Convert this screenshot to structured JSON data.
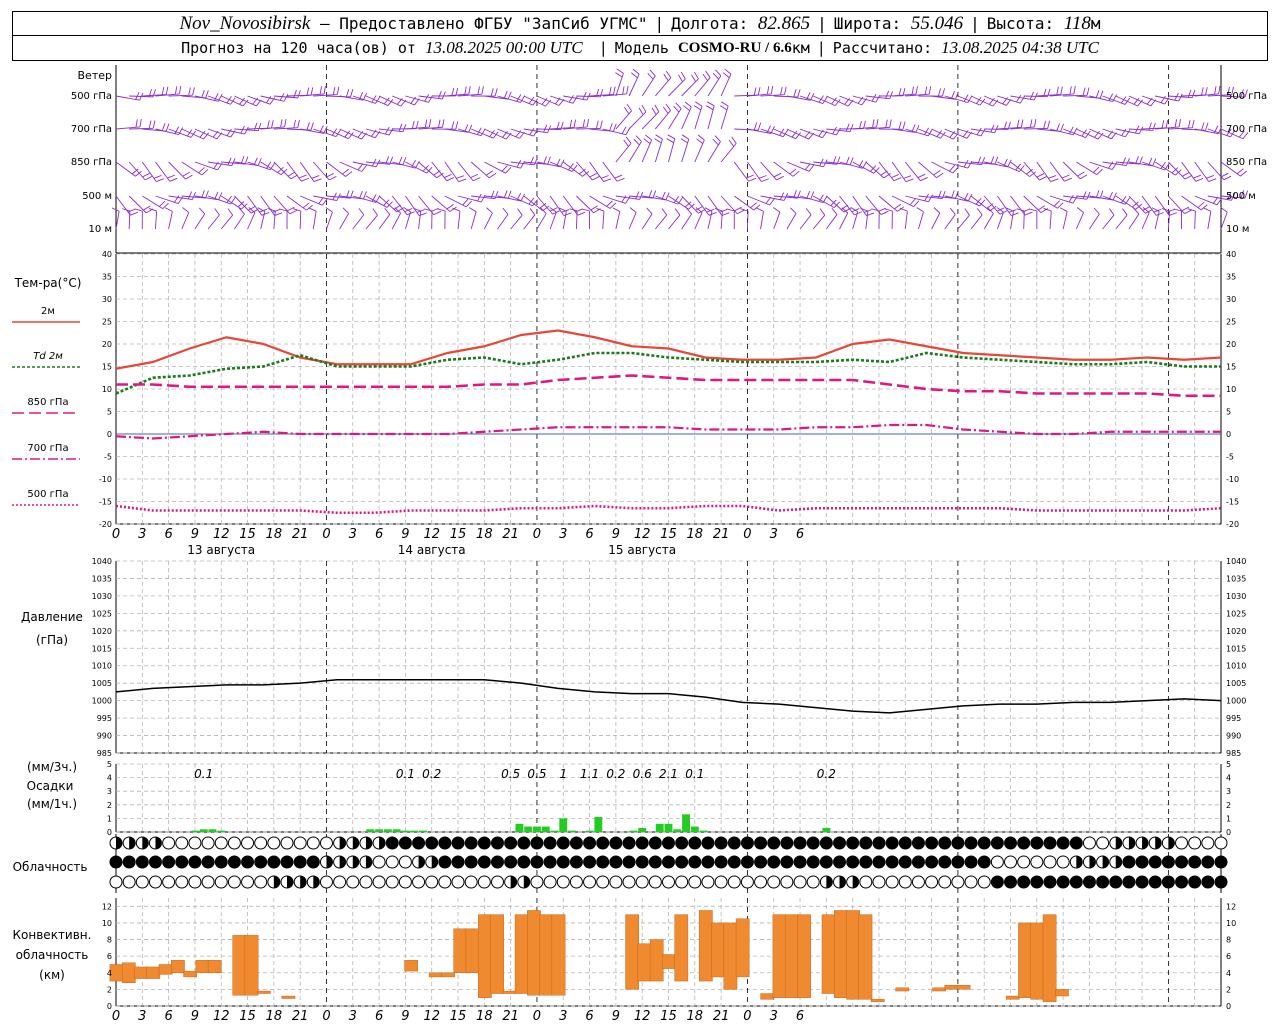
{
  "header": {
    "station": "Nov_Novosibirsk",
    "provider": "– Предоставлено ФГБУ \"ЗапСиб УГМС\"",
    "lon_label": "Долгота:",
    "lon": "82.865",
    "lat_label": "Широта:",
    "lat": "55.046",
    "alt_label": "Высота:",
    "alt": "118",
    "alt_unit": "м",
    "forecast_prefix": "Прогноз на 120 часа(ов) от",
    "run_time": "13.08.2025 00:00 UTC",
    "model_label": "Модель",
    "model": "COSMO-RU / 6.6",
    "model_unit": "км",
    "calc_label": "Рассчитано:",
    "calc_time": "13.08.2025 04:38 UTC"
  },
  "colors": {
    "wind": "#8b2bd0",
    "t2m": "#e8463a",
    "td2m": "#1b7a1b",
    "t850": "#e0187e",
    "precip": "#22cc22",
    "convective": "#f08a30",
    "pressure": "#000000"
  },
  "wind_panel": {
    "title": "Ветер",
    "levels": [
      "500 гПа",
      "700 гПа",
      "850 гПа",
      "500 м",
      "10  м"
    ]
  },
  "temp_legend": {
    "title": "Тем-ра(°C)",
    "items": [
      {
        "label": "2м",
        "prefix": "",
        "color": "#e8463a",
        "dash": ""
      },
      {
        "label": "2м",
        "prefix": "Td",
        "color": "#1b7a1b",
        "dash": "3,2"
      },
      {
        "label": "850 гПа",
        "prefix": "",
        "color": "#e0187e",
        "dash": "12,5"
      },
      {
        "label": "700 гПа",
        "prefix": "",
        "color": "#e0187e",
        "dash": "10,3,2,3"
      },
      {
        "label": "500 гПа",
        "prefix": "",
        "color": "#e0187e",
        "dash": "2,2"
      }
    ]
  },
  "time_axis": {
    "hour_labels": [
      "0",
      "3",
      "6",
      "9",
      "12",
      "15",
      "18",
      "21",
      "0",
      "3",
      "6",
      "9",
      "12",
      "15",
      "18",
      "21",
      "0",
      "3",
      "6",
      "9",
      "12",
      "15",
      "18",
      "21",
      "0",
      "3",
      "6"
    ],
    "day_labels": [
      "13 августа",
      "14 августа",
      "15 августа"
    ]
  },
  "pressure_panel": {
    "title_line1": "Давление",
    "title_line2": "(гПа)"
  },
  "precip_panel": {
    "label_3h": "(мм/3ч.)",
    "title": "Осадки",
    "label_1h": "(мм/1ч.)",
    "totals": [
      {
        "hour": 10,
        "text": "0.1"
      },
      {
        "hour": 33,
        "text": "0.1"
      },
      {
        "hour": 36,
        "text": "0.2"
      },
      {
        "hour": 45,
        "text": "0.5"
      },
      {
        "hour": 48,
        "text": "0.5"
      },
      {
        "hour": 51,
        "text": "1"
      },
      {
        "hour": 54,
        "text": "1.1"
      },
      {
        "hour": 57,
        "text": "0.2"
      },
      {
        "hour": 60,
        "text": "0.6"
      },
      {
        "hour": 63,
        "text": "2.1"
      },
      {
        "hour": 66,
        "text": "0.1"
      },
      {
        "hour": 81,
        "text": "0.2"
      }
    ]
  },
  "cloud_panel": {
    "title": "Облачность"
  },
  "conv_panel": {
    "title_line1": "Конвективн.",
    "title_line2": "облачность",
    "title_line3": "(км)"
  },
  "chart_data": [
    {
      "type": "line",
      "title": "Тем-ра(°C)",
      "x_unit": "hours from 13.08.2025 00:00 UTC",
      "ylim": [
        -20,
        40
      ],
      "grid": true,
      "x": [
        0,
        3,
        6,
        9,
        12,
        15,
        18,
        21,
        24,
        27,
        30,
        33,
        36,
        39,
        42,
        45,
        48,
        51,
        54,
        57,
        60,
        63,
        66,
        69,
        72,
        75,
        78,
        81,
        84,
        87,
        90
      ],
      "series": [
        {
          "name": "2м",
          "values": [
            14.5,
            16,
            19,
            21.5,
            20,
            17,
            15.5,
            15.5,
            15.5,
            18,
            19.5,
            22,
            23,
            21.5,
            19.5,
            19,
            17,
            16.5,
            16.5,
            17,
            20,
            21,
            19.5,
            18,
            17.5,
            17,
            16.5,
            16.5,
            17,
            16.5,
            17
          ]
        },
        {
          "name": "Td 2м",
          "values": [
            9,
            12.5,
            13,
            14.5,
            15,
            17.5,
            15,
            15,
            15,
            16.5,
            17,
            15.5,
            16.5,
            18,
            18,
            17,
            16.5,
            16,
            16,
            16,
            16.5,
            16,
            18,
            17,
            16.5,
            16,
            15.5,
            15.5,
            16,
            15,
            15
          ]
        },
        {
          "name": "850 гПа",
          "values": [
            11,
            11,
            10.5,
            10.5,
            10.5,
            10.5,
            10.5,
            10.5,
            10.5,
            10.5,
            11,
            11,
            12,
            12.5,
            13,
            12.5,
            12,
            12,
            12,
            12,
            12,
            11,
            10,
            9.5,
            9.5,
            9,
            9,
            9,
            9,
            8.5,
            8.5
          ]
        },
        {
          "name": "700 гПа",
          "values": [
            -0.5,
            -1,
            -0.5,
            0,
            0.5,
            0,
            0,
            0,
            0,
            0,
            0.5,
            1,
            1.5,
            1.5,
            1.5,
            1.5,
            1,
            1,
            1,
            1.5,
            1.5,
            2,
            2,
            1,
            0.5,
            0,
            0,
            0.5,
            0.5,
            0.5,
            0.5
          ]
        },
        {
          "name": "500 гПа",
          "values": [
            -16,
            -17,
            -17,
            -17,
            -17,
            -17,
            -17.5,
            -17.5,
            -17,
            -17,
            -17,
            -16.5,
            -16.5,
            -16,
            -16.5,
            -16.5,
            -16,
            -16,
            -17,
            -16.5,
            -16.5,
            -16.5,
            -16.5,
            -16.5,
            -16.5,
            -17,
            -17,
            -17,
            -17,
            -17,
            -16.5
          ]
        }
      ]
    },
    {
      "type": "line",
      "title": "Давление (гПа)",
      "ylim": [
        985,
        1040
      ],
      "grid": true,
      "x": [
        0,
        3,
        6,
        9,
        12,
        15,
        18,
        21,
        24,
        27,
        30,
        33,
        36,
        39,
        42,
        45,
        48,
        51,
        54,
        57,
        60,
        63,
        66,
        69,
        72,
        75,
        78,
        81,
        84,
        87,
        90
      ],
      "series": [
        {
          "name": "",
          "values": [
            1002.5,
            1003.5,
            1004,
            1004.5,
            1004.5,
            1005,
            1006,
            1006,
            1006,
            1006,
            1006,
            1005,
            1003.5,
            1002.5,
            1002,
            1002,
            1001,
            999.5,
            999,
            998,
            997,
            996.5,
            997.5,
            998.5,
            999,
            999,
            999.5,
            999.5,
            1000,
            1000.5,
            1000
          ]
        }
      ]
    },
    {
      "type": "bar",
      "title": "Осадки (мм/1ч.)",
      "ylim": [
        0,
        5
      ],
      "x": [
        9,
        10,
        11,
        12,
        29,
        30,
        31,
        32,
        33,
        34,
        35,
        46,
        47,
        48,
        49,
        50,
        51,
        52,
        54,
        55,
        59,
        60,
        62,
        63,
        64,
        65,
        66,
        67,
        81
      ],
      "values": [
        0.1,
        0.2,
        0.2,
        0.1,
        0.2,
        0.2,
        0.2,
        0.2,
        0.1,
        0.1,
        0.1,
        0.6,
        0.4,
        0.4,
        0.4,
        0.1,
        1.0,
        0.1,
        0.1,
        1.1,
        0.1,
        0.3,
        0.6,
        0.6,
        0.2,
        1.3,
        0.4,
        0.1,
        0.3
      ]
    },
    {
      "type": "bar",
      "title": "Конвективн. облачность (км)",
      "ylim": [
        0,
        13
      ],
      "bars": [
        {
          "x": 0,
          "base": 3.0,
          "top": 5.0
        },
        {
          "x": 1,
          "base": 2.8,
          "top": 5.2
        },
        {
          "x": 2,
          "base": 3.3,
          "top": 4.7
        },
        {
          "x": 3,
          "base": 3.3,
          "top": 4.7
        },
        {
          "x": 4,
          "base": 3.8,
          "top": 5.0
        },
        {
          "x": 5,
          "base": 4.0,
          "top": 5.5
        },
        {
          "x": 6,
          "base": 3.5,
          "top": 4.2
        },
        {
          "x": 7,
          "base": 4.0,
          "top": 5.5
        },
        {
          "x": 8,
          "base": 4.0,
          "top": 5.5
        },
        {
          "x": 10,
          "base": 1.3,
          "top": 8.5
        },
        {
          "x": 11,
          "base": 1.3,
          "top": 8.5
        },
        {
          "x": 12,
          "base": 1.5,
          "top": 1.8
        },
        {
          "x": 14,
          "base": 0.9,
          "top": 1.2
        },
        {
          "x": 24,
          "base": 4.2,
          "top": 5.5
        },
        {
          "x": 26,
          "base": 3.5,
          "top": 4.0
        },
        {
          "x": 27,
          "base": 3.5,
          "top": 4.0
        },
        {
          "x": 28,
          "base": 4.0,
          "top": 9.3
        },
        {
          "x": 29,
          "base": 4.0,
          "top": 9.3
        },
        {
          "x": 30,
          "base": 1.0,
          "top": 11.0
        },
        {
          "x": 31,
          "base": 1.5,
          "top": 11.0
        },
        {
          "x": 32,
          "base": 1.5,
          "top": 1.8
        },
        {
          "x": 33,
          "base": 1.5,
          "top": 11.0
        },
        {
          "x": 34,
          "base": 1.3,
          "top": 11.5
        },
        {
          "x": 35,
          "base": 1.3,
          "top": 11.0
        },
        {
          "x": 36,
          "base": 1.3,
          "top": 11.0
        },
        {
          "x": 42,
          "base": 2.0,
          "top": 11.0
        },
        {
          "x": 43,
          "base": 3.0,
          "top": 7.5
        },
        {
          "x": 44,
          "base": 3.0,
          "top": 8.0
        },
        {
          "x": 45,
          "base": 4.5,
          "top": 6.2
        },
        {
          "x": 46,
          "base": 3.0,
          "top": 11.0
        },
        {
          "x": 48,
          "base": 3.0,
          "top": 11.5
        },
        {
          "x": 49,
          "base": 3.5,
          "top": 10.0
        },
        {
          "x": 50,
          "base": 2.0,
          "top": 10.0
        },
        {
          "x": 51,
          "base": 3.5,
          "top": 10.5
        },
        {
          "x": 53,
          "base": 0.8,
          "top": 1.5
        },
        {
          "x": 54,
          "base": 1.0,
          "top": 11.0
        },
        {
          "x": 55,
          "base": 1.0,
          "top": 11.0
        },
        {
          "x": 56,
          "base": 1.0,
          "top": 11.0
        },
        {
          "x": 58,
          "base": 1.5,
          "top": 11.0
        },
        {
          "x": 59,
          "base": 1.0,
          "top": 11.5
        },
        {
          "x": 60,
          "base": 0.8,
          "top": 11.5
        },
        {
          "x": 61,
          "base": 0.8,
          "top": 11.0
        },
        {
          "x": 62,
          "base": 0.5,
          "top": 0.8
        },
        {
          "x": 64,
          "base": 1.8,
          "top": 2.2
        },
        {
          "x": 67,
          "base": 1.8,
          "top": 2.2
        },
        {
          "x": 68,
          "base": 2.0,
          "top": 2.5
        },
        {
          "x": 69,
          "base": 2.0,
          "top": 2.5
        },
        {
          "x": 73,
          "base": 0.8,
          "top": 1.2
        },
        {
          "x": 74,
          "base": 1.0,
          "top": 10.0
        },
        {
          "x": 75,
          "base": 0.8,
          "top": 10.0
        },
        {
          "x": 76,
          "base": 0.5,
          "top": 11.0
        },
        {
          "x": 77,
          "base": 1.2,
          "top": 2.0
        }
      ]
    }
  ]
}
